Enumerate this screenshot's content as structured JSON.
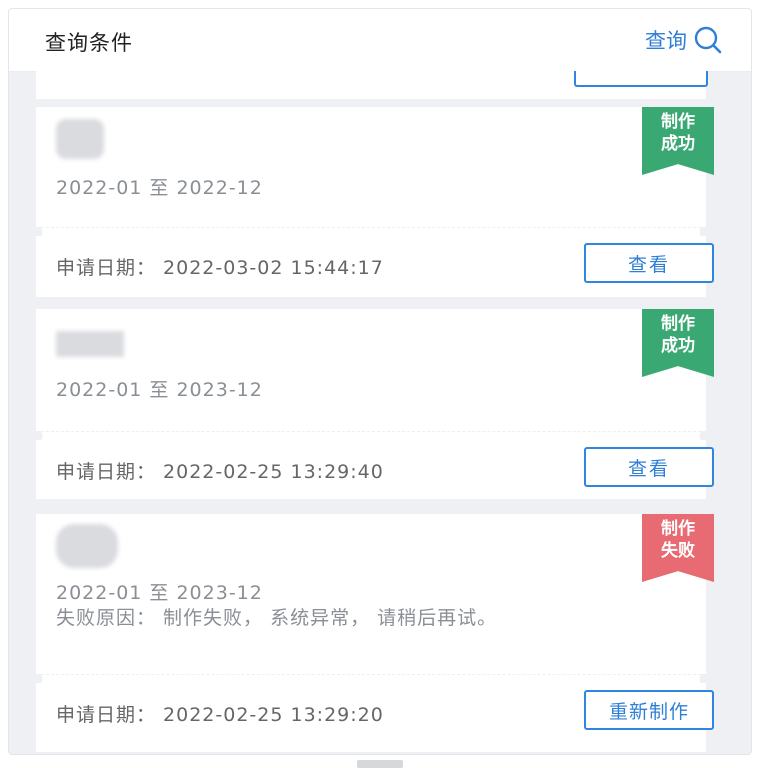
{
  "header": {
    "title": "查询条件",
    "search_label": "查询"
  },
  "colors": {
    "accent": "#2f7fd6",
    "success": "#3aa872",
    "fail": "#e86a72",
    "background": "#eef0f3"
  },
  "records": [
    {
      "period": "2022-01 至 2022-12",
      "status": [
        "制作",
        "成功"
      ],
      "status_type": "success",
      "apply_date": "申请日期：  2022-03-02 15:44:17",
      "action": "查看"
    },
    {
      "period": "2022-01 至 2023-12",
      "status": [
        "制作",
        "成功"
      ],
      "status_type": "success",
      "apply_date": "申请日期：  2022-02-25 13:29:40",
      "action": "查看"
    },
    {
      "period": "2022-01 至 2023-12",
      "reason": "失败原因：  制作失败，  系统异常，  请稍后再试。",
      "status": [
        "制作",
        "失败"
      ],
      "status_type": "fail",
      "apply_date": "申请日期：  2022-02-25 13:29:20",
      "action": "重新制作"
    }
  ]
}
